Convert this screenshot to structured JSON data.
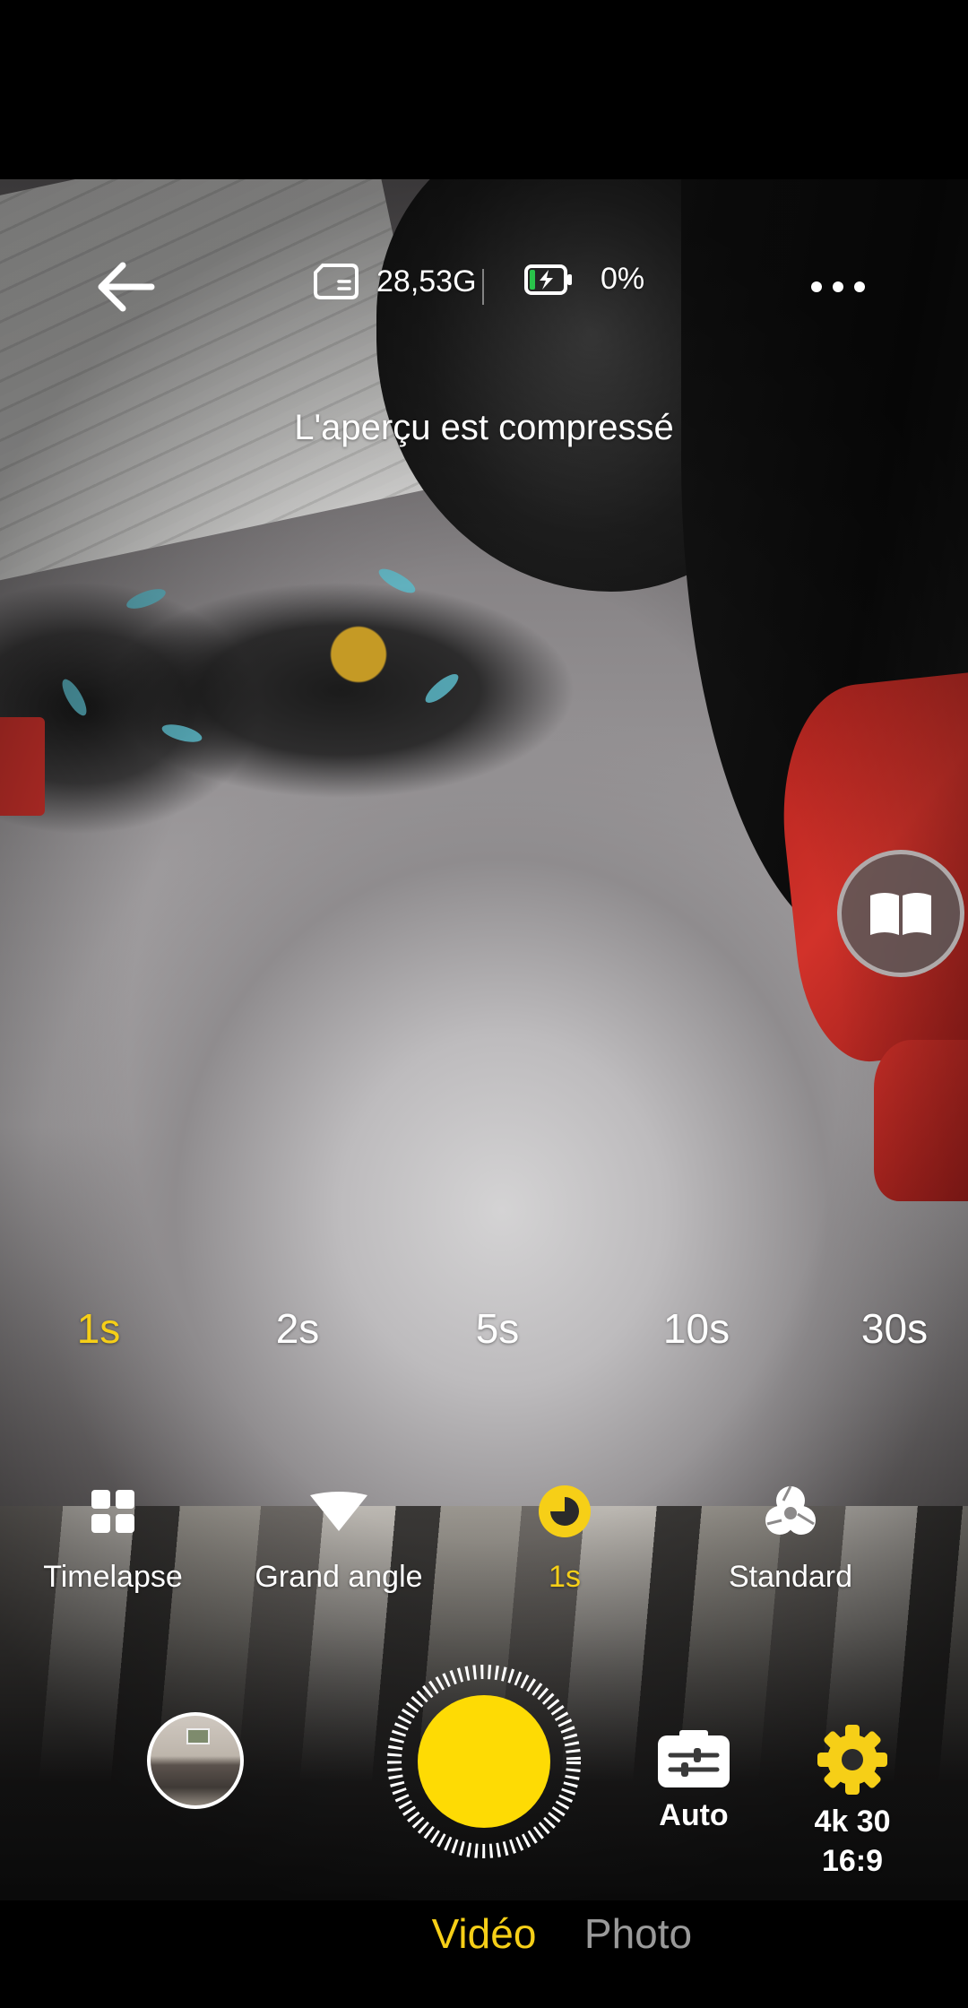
{
  "status": {
    "storage_text": "28,53G",
    "battery_text": "0%",
    "storage_icon": "sd-card-icon",
    "battery_icon": "battery-charging-icon"
  },
  "preview": {
    "note": "L'aperçu est compressé"
  },
  "interval": {
    "options": [
      "1s",
      "2s",
      "5s",
      "10s",
      "30s"
    ],
    "selected": "1s"
  },
  "modes": [
    {
      "icon": "grid-icon",
      "label": "Timelapse"
    },
    {
      "icon": "wide-angle-icon",
      "label": "Grand angle"
    },
    {
      "icon": "timer-icon",
      "label": "1s",
      "active": true
    },
    {
      "icon": "filter-icon",
      "label": "Standard"
    }
  ],
  "controls": {
    "auto_label": "Auto",
    "resolution_line1": "4k 30",
    "resolution_line2": "16:9"
  },
  "tabs": [
    {
      "label": "Vidéo",
      "active": true
    },
    {
      "label": "Photo",
      "active": false
    }
  ],
  "colors": {
    "accent": "#f6cf17",
    "shutter": "#fedb04",
    "inactive_tab": "#9a9a9a"
  }
}
